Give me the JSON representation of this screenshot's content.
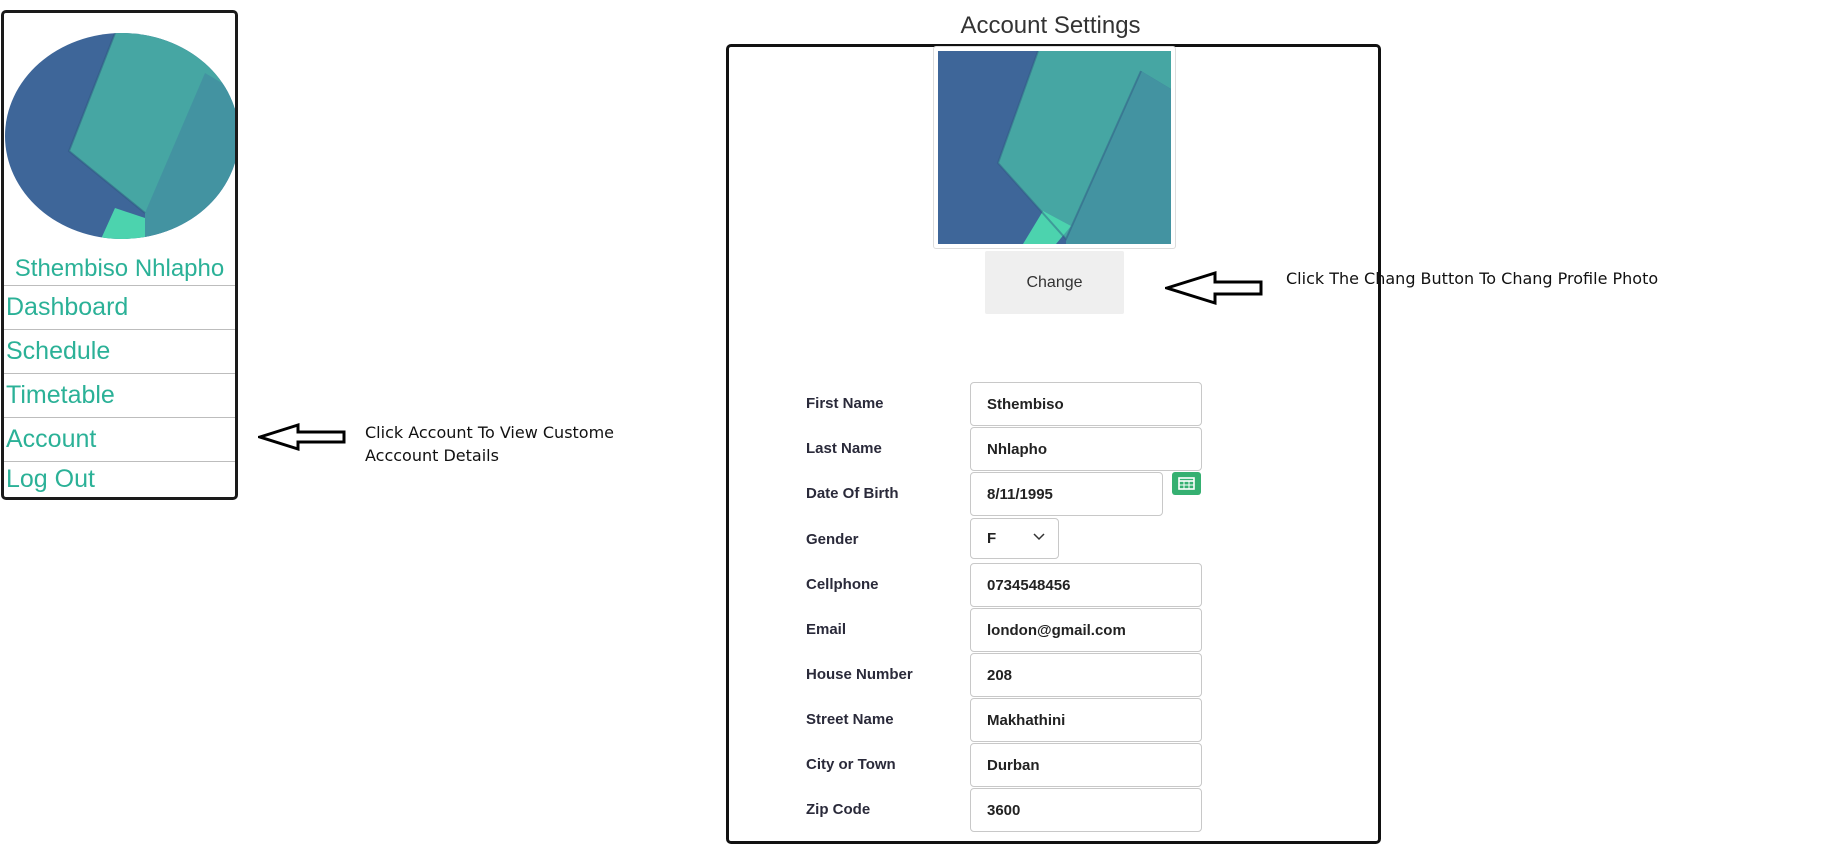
{
  "sidebar": {
    "user_name": "Sthembiso Nhlapho",
    "menu": [
      {
        "label": "Dashboard"
      },
      {
        "label": "Schedule"
      },
      {
        "label": "Timetable"
      },
      {
        "label": "Account"
      },
      {
        "label": "Log Out"
      }
    ]
  },
  "annotations": {
    "account_note": [
      "Click Account To View Custome",
      "Acccount Details"
    ],
    "change_note": "Click The Chang Button To Chang Profile Photo"
  },
  "settings": {
    "title": "Account Settings",
    "change_label": "Change",
    "fields": {
      "first_name": {
        "label": "First Name",
        "value": "Sthembiso"
      },
      "last_name": {
        "label": "Last Name",
        "value": "Nhlapho"
      },
      "dob": {
        "label": "Date Of Birth",
        "value": "8/11/1995"
      },
      "gender": {
        "label": "Gender",
        "value": "F"
      },
      "cellphone": {
        "label": "Cellphone",
        "value": "0734548456"
      },
      "email": {
        "label": "Email",
        "value": "london@gmail.com"
      },
      "house_number": {
        "label": "House Number",
        "value": "208"
      },
      "street_name": {
        "label": "Street Name",
        "value": "Makhathini"
      },
      "city": {
        "label": "City or Town",
        "value": "Durban"
      },
      "zip": {
        "label": "Zip Code",
        "value": "3600"
      }
    }
  },
  "colors": {
    "accent": "#2bb197",
    "calendar_button": "#35b071",
    "photo_blue": "#3e6699",
    "photo_teal": "#46a6a3",
    "photo_mint": "#4cd3ae"
  },
  "icons": [
    "calendar-icon",
    "chevron-down-icon",
    "left-arrow-icon"
  ]
}
